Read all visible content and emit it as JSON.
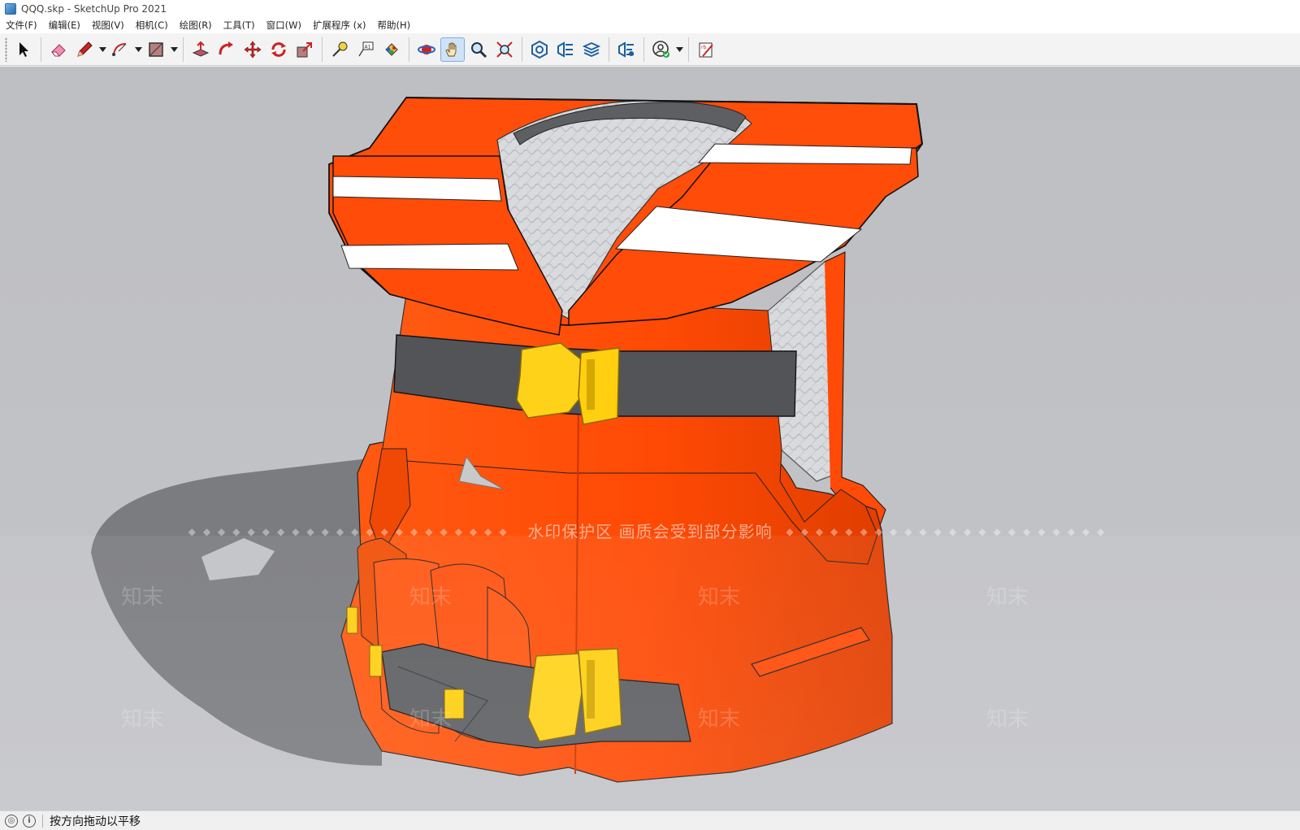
{
  "window": {
    "title": "QQQ.skp - SketchUp Pro 2021"
  },
  "menu": [
    {
      "label": "文件(F)"
    },
    {
      "label": "编辑(E)"
    },
    {
      "label": "视图(V)"
    },
    {
      "label": "相机(C)"
    },
    {
      "label": "绘图(R)"
    },
    {
      "label": "工具(T)"
    },
    {
      "label": "窗口(W)"
    },
    {
      "label": "扩展程序 (x)"
    },
    {
      "label": "帮助(H)"
    }
  ],
  "toolbar": {
    "tools": [
      "select-icon",
      "eraser-icon",
      "pencil-icon",
      "arc-icon",
      "rectangle-icon",
      "push-pull-icon",
      "follow-me-icon",
      "move-icon",
      "rotate-icon",
      "scale-icon",
      "tape-measure-icon",
      "text-icon",
      "paint-bucket-icon",
      "orbit-icon",
      "pan-icon",
      "zoom-icon",
      "zoom-extents-icon",
      "warehouse-icon",
      "extension-warehouse-icon",
      "layout-icon",
      "extension-manager-icon",
      "account-icon",
      "style-builder-icon"
    ],
    "active_tool": "pan-icon"
  },
  "viewport": {
    "watermark_banner": "水印保护区  画质会受到部分影响",
    "watermark_mark": "知末"
  },
  "colors": {
    "vest_orange": "#ff4a0a",
    "reflective_white": "#ffffff",
    "strap_gray": "#555555",
    "buckle_yellow": "#ffd21a",
    "background": "#c0c1c5"
  },
  "status": {
    "hint": "按方向拖动以平移"
  }
}
